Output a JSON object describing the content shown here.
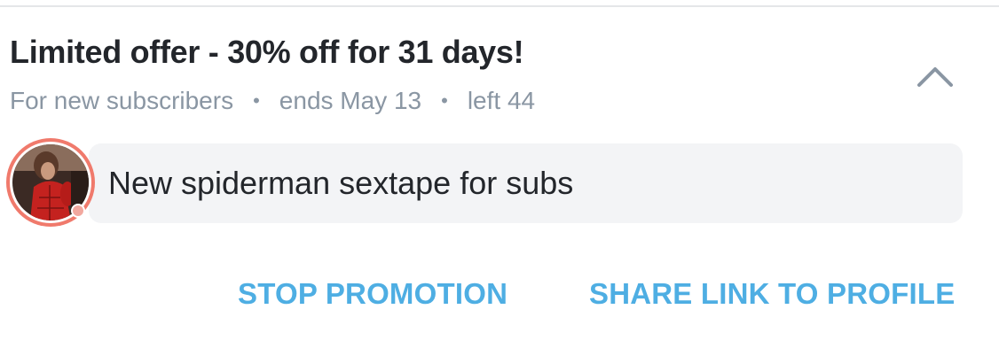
{
  "promotion": {
    "title": "Limited offer - 30% off for 31 days!",
    "audience": "For new subscribers",
    "ends": "ends May 13",
    "remaining": "left 44",
    "separator": "•",
    "message": "New spiderman sextape for subs"
  },
  "actions": {
    "stop_label": "STOP PROMOTION",
    "share_label": "SHARE LINK TO PROFILE"
  },
  "icons": {
    "collapse": "chevron-up-icon",
    "avatar": "avatar"
  },
  "colors": {
    "accent": "#4eaee3",
    "muted_text": "#8a96a3",
    "primary_text": "#23262b",
    "avatar_ring": "#f07a6c",
    "message_bg": "#f3f4f6"
  }
}
